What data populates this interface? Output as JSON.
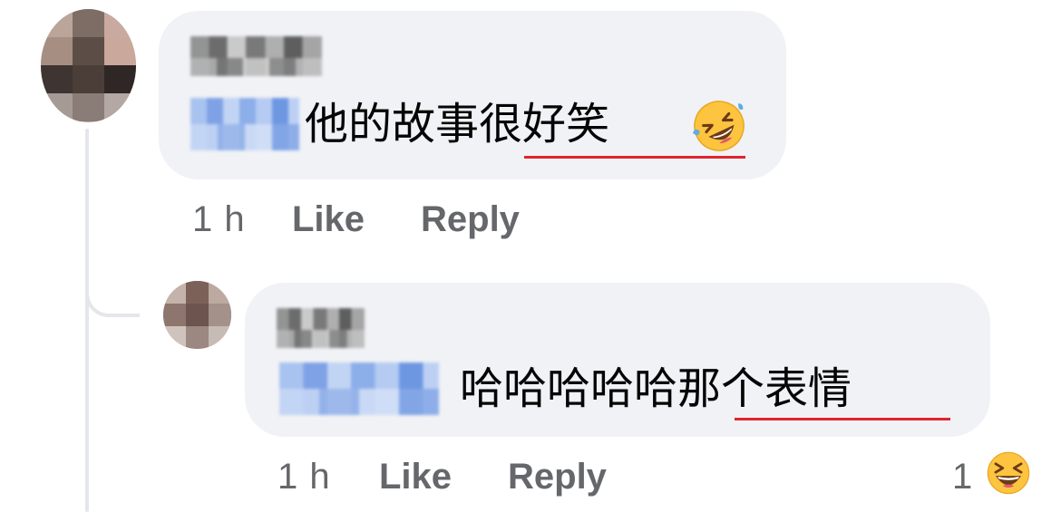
{
  "comments": [
    {
      "text": "他的故事很好笑",
      "underlined_text": "很好笑",
      "emoji": "rolling-on-floor-laughing",
      "time": "1 h",
      "like_label": "Like",
      "reply_label": "Reply"
    },
    {
      "text": "哈哈哈哈哈那个表情",
      "underlined_text": "那个表情",
      "time": "1 h",
      "like_label": "Like",
      "reply_label": "Reply",
      "reaction": {
        "count": "1",
        "emoji": "laughing-face"
      }
    }
  ],
  "colors": {
    "bubble": "#f0f2f5",
    "meta_text": "#65676b",
    "body_text": "#050505",
    "underline": "#e0242f",
    "thread_line": "#e4e6eb",
    "emoji_yellow": "#fcc43f"
  }
}
